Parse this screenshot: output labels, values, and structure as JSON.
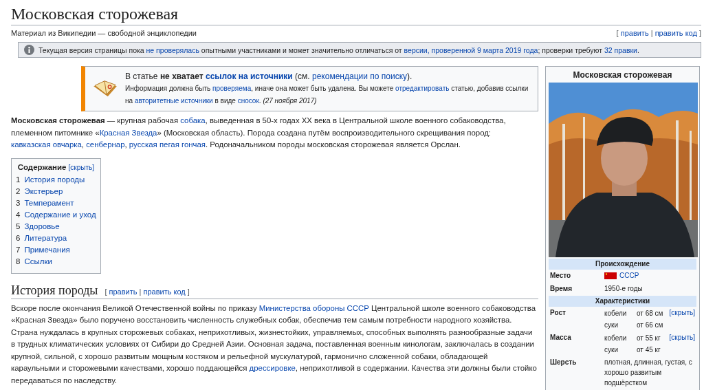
{
  "title": "Московская сторожевая",
  "subtitle": "Материал из Википедии — свободной энциклопедии",
  "edit_links": [
    {
      "kind": "plain",
      "text": "[ "
    },
    {
      "kind": "link",
      "text": "править"
    },
    {
      "kind": "plain",
      "text": " | "
    },
    {
      "kind": "link",
      "text": "править код"
    },
    {
      "kind": "plain",
      "text": " ]"
    }
  ],
  "notice": [
    {
      "kind": "plain",
      "text": "Текущая версия страницы пока "
    },
    {
      "kind": "link",
      "text": "не проверялась"
    },
    {
      "kind": "plain",
      "text": " опытными участниками и может значительно отличаться от "
    },
    {
      "kind": "link",
      "text": "версии, проверенной 9 марта 2019 года"
    },
    {
      "kind": "plain",
      "text": "; проверки требуют "
    },
    {
      "kind": "link",
      "text": "32 правки"
    },
    {
      "kind": "plain",
      "text": "."
    }
  ],
  "ambox": {
    "line1": [
      {
        "kind": "plain",
        "text": "В статье "
      },
      {
        "kind": "bold",
        "text": "не хватает "
      },
      {
        "kind": "boldlink",
        "text": "ссылок на источники"
      },
      {
        "kind": "plain",
        "text": " (см. "
      },
      {
        "kind": "link",
        "text": "рекомендации по поиску"
      },
      {
        "kind": "plain",
        "text": ")."
      }
    ],
    "line2": [
      {
        "kind": "plain",
        "text": "Информация должна быть "
      },
      {
        "kind": "link",
        "text": "проверяема"
      },
      {
        "kind": "plain",
        "text": ", иначе она может быть удалена. Вы можете "
      },
      {
        "kind": "link",
        "text": "отредактировать"
      },
      {
        "kind": "plain",
        "text": " статью, добавив ссылки на "
      },
      {
        "kind": "link",
        "text": "авторитетные источники"
      },
      {
        "kind": "plain",
        "text": " в виде "
      },
      {
        "kind": "link",
        "text": "сносок"
      },
      {
        "kind": "plain",
        "text": ". "
      },
      {
        "kind": "italic",
        "text": "(27 ноября 2017)"
      }
    ]
  },
  "intro": [
    {
      "kind": "bold",
      "text": "Московская сторожевая"
    },
    {
      "kind": "plain",
      "text": " — крупная рабочая "
    },
    {
      "kind": "link",
      "text": "собака"
    },
    {
      "kind": "plain",
      "text": ", выведенная в 50-х годах XX века в Центральной школе военного собаководства, племенном питомнике «"
    },
    {
      "kind": "link",
      "text": "Красная Звезда"
    },
    {
      "kind": "plain",
      "text": "» (Московская область). Порода создана путём воспроизводительного скрещивания пород: "
    },
    {
      "kind": "link",
      "text": "кавказская овчарка"
    },
    {
      "kind": "plain",
      "text": ", "
    },
    {
      "kind": "link",
      "text": "сенбернар"
    },
    {
      "kind": "plain",
      "text": ", "
    },
    {
      "kind": "link",
      "text": "русская пегая гончая"
    },
    {
      "kind": "plain",
      "text": ". Родоначальником породы московская сторожевая является Орслан."
    }
  ],
  "toc": {
    "title": "Содержание",
    "toggle": "[скрыть]",
    "items": [
      {
        "number": "1",
        "label": "История породы"
      },
      {
        "number": "2",
        "label": "Экстерьер"
      },
      {
        "number": "3",
        "label": "Темперамент"
      },
      {
        "number": "4",
        "label": "Содержание и уход"
      },
      {
        "number": "5",
        "label": "Здоровье"
      },
      {
        "number": "6",
        "label": "Литература"
      },
      {
        "number": "7",
        "label": "Примечания"
      },
      {
        "number": "8",
        "label": "Ссылки"
      }
    ]
  },
  "section": {
    "heading": "История породы",
    "edit_links": [
      {
        "kind": "plain",
        "text": "[ "
      },
      {
        "kind": "link",
        "text": "править"
      },
      {
        "kind": "plain",
        "text": " | "
      },
      {
        "kind": "link",
        "text": "править код"
      },
      {
        "kind": "plain",
        "text": " ]"
      }
    ],
    "paragraph": [
      {
        "kind": "plain",
        "text": "Вскоре после окончания Великой Отечественной войны по приказу "
      },
      {
        "kind": "link",
        "text": "Министерства обороны СССР"
      },
      {
        "kind": "plain",
        "text": " Центральной школе военного собаководства «Красная Звезда» было поручено восстановить численность служебных собак, обеспечив тем самым потребности народного хозяйства. Страна нуждалась в крупных сторожевых собаках, неприхотливых, жизнестойких, управляемых, способных выполнять разнообразные задачи в трудных климатических условиях от Сибири до Средней Азии. Основная задача, поставленная военным кинологам, заключалась в создании крупной, сильной, с хорошо развитым мощным костяком и рельефной мускулатурой, гармонично сложенной собаки, обладающей караульными и сторожевыми качествами, хорошо поддающейся "
      },
      {
        "kind": "link",
        "text": "дрессировке"
      },
      {
        "kind": "plain",
        "text": ", неприхотливой в содержании. Качества эти должны были стойко передаваться по наследству."
      }
    ]
  },
  "infobox": {
    "title": "Московская сторожевая",
    "groups": [
      {
        "header": "Происхождение",
        "rows": [
          {
            "kind": "flag",
            "label": "Место",
            "value": "СССР"
          },
          {
            "kind": "text",
            "label": "Время",
            "value": "1950-е годы"
          }
        ]
      },
      {
        "header": "Характеристики",
        "rows": [
          {
            "kind": "sub",
            "label": "Рост",
            "toggle": "[скрыть]",
            "items": [
              {
                "sex": "кобели",
                "value": "от 68 см"
              },
              {
                "sex": "суки",
                "value": "от 66 см"
              }
            ]
          },
          {
            "kind": "sub",
            "label": "Масса",
            "toggle": "[скрыть]",
            "items": [
              {
                "sex": "кобели",
                "value": "от 55 кг"
              },
              {
                "sex": "суки",
                "value": "от 45 кг"
              }
            ]
          },
          {
            "kind": "text",
            "label": "Шерсть",
            "value": "плотная, длинная, густая, с хорошо развитым подшёрстком"
          }
        ]
      }
    ]
  }
}
